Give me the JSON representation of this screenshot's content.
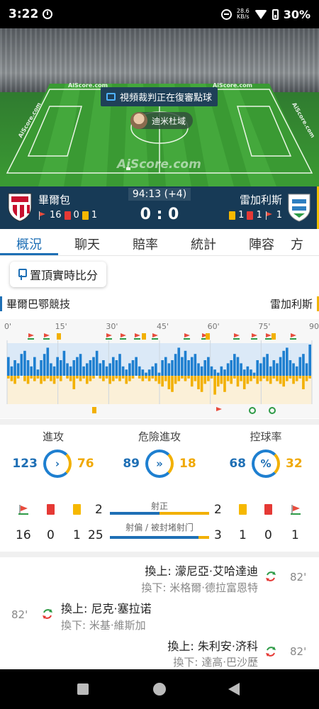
{
  "status": {
    "time": "3:22",
    "net_speed": "28.6",
    "net_unit": "KB/s",
    "battery": "30%"
  },
  "pitch": {
    "banner": "視頻裁判正在復審點球",
    "player": "迪米杜域",
    "watermark": "AiScore.com",
    "watermark_small": "AiScore.com"
  },
  "match": {
    "minute": "94:13 (+4)",
    "score": "0 : 0",
    "home": {
      "name": "畢爾包",
      "corners": "16",
      "reds": "0",
      "yellows": "1"
    },
    "away": {
      "name": "雷加利斯",
      "yellows": "1",
      "reds": "1",
      "corners": "1"
    }
  },
  "tabs": [
    "概況",
    "聊天",
    "賠率",
    "統計",
    "陣容",
    "方"
  ],
  "pin_button": "置頂實時比分",
  "team_labels": {
    "home": "畢爾巴鄂競技",
    "away": "雷加利斯"
  },
  "timeline": {
    "ticks": [
      "0'",
      "15'",
      "30'",
      "45'",
      "60'",
      "75'",
      "90'"
    ],
    "home_pressure": [
      0.6,
      0.3,
      0.5,
      0.4,
      0.7,
      0.8,
      0.5,
      0.3,
      0.6,
      0.2,
      0.5,
      0.7,
      0.9,
      0.4,
      0.3,
      0.6,
      0.5,
      0.8,
      0.4,
      0.3,
      0.5,
      0.6,
      0.7,
      0.3,
      0.4,
      0.5,
      0.6,
      0.8,
      0.4,
      0.5,
      0.3,
      0.4,
      0.6,
      0.5,
      0.7,
      0.3,
      0.2,
      0.4,
      0.5,
      0.6,
      0.3,
      0.2,
      0.1,
      0.2,
      0.3,
      0.4,
      0.1,
      0.5,
      0.6,
      0.4,
      0.5,
      0.7,
      0.9,
      0.6,
      0.8,
      0.5,
      0.6,
      0.7,
      0.4,
      0.3,
      0.5,
      0.6,
      0.3,
      0.2,
      0.1,
      0.3,
      0.2,
      0.4,
      0.5,
      0.7,
      0.6,
      0.4,
      0.2,
      0.3,
      0.2,
      0.1,
      0.5,
      0.4,
      0.6,
      0.7,
      0.3,
      0.5,
      0.4,
      0.6,
      0.8,
      0.9,
      0.5,
      0.4,
      0.3,
      0.6,
      0.7,
      0.4,
      1.0
    ],
    "away_pressure": [
      0.1,
      0.2,
      0.3,
      0.1,
      0.0,
      0.2,
      0.3,
      0.1,
      0.2,
      0.1,
      0.3,
      0.2,
      0.1,
      0.2,
      0.3,
      0.1,
      0.2,
      0.0,
      0.1,
      0.2,
      0.5,
      0.1,
      0.2,
      0.1,
      0.3,
      0.2,
      0.1,
      0.0,
      0.1,
      0.2,
      0.1,
      0.3,
      0.2,
      0.1,
      0.2,
      0.1,
      0.3,
      0.2,
      0.1,
      0.0,
      0.1,
      0.2,
      0.1,
      0.2,
      0.1,
      0.2,
      0.3,
      0.4,
      0.2,
      0.5,
      0.6,
      0.3,
      0.2,
      0.1,
      0.2,
      0.1,
      0.4,
      0.2,
      0.5,
      0.6,
      0.3,
      0.2,
      0.1,
      0.7,
      0.4,
      0.3,
      0.6,
      0.2,
      0.3,
      0.1,
      0.4,
      0.2,
      0.5,
      0.3,
      0.2,
      0.1,
      0.3,
      0.2,
      0.1,
      0.2,
      0.3,
      0.1,
      0.2,
      0.3,
      0.4,
      0.2,
      0.1,
      0.3,
      0.2,
      0.1,
      0.5,
      0.2,
      0.1
    ]
  },
  "key_stats": [
    {
      "label": "進攻",
      "home": "123",
      "away": "76",
      "icon": "chevron-right-icon"
    },
    {
      "label": "危險進攻",
      "home": "89",
      "away": "18",
      "icon": "double-chevron-icon"
    },
    {
      "label": "控球率",
      "home": "68",
      "away": "32",
      "icon": "percent-icon",
      "symbol": "%"
    }
  ],
  "shots": {
    "on_target_label": "射正",
    "off_target_label": "射偏 / 被封堵射门",
    "home_on": "2",
    "away_on": "2",
    "home_off": "25",
    "away_off": "3",
    "home_on_ratio": 0.5,
    "home_off_ratio": 0.89,
    "home_corners": "16",
    "home_reds": "0",
    "home_yellows": "1",
    "away_yellows": "1",
    "away_reds": "0",
    "away_corners": "1"
  },
  "events": [
    {
      "side": "away",
      "minute": "82'",
      "in": "換上: 濛尼亞·艾哈達迪",
      "out": "換下: 米格爾·德拉富恩特"
    },
    {
      "side": "home",
      "minute": "82'",
      "in": "換上: 尼克·塞拉诺",
      "out": "換下: 米基·維斯加"
    },
    {
      "side": "away",
      "minute": "82'",
      "in": "換上: 朱利安·济科",
      "out": "換下: 達高·巴沙歷"
    }
  ]
}
